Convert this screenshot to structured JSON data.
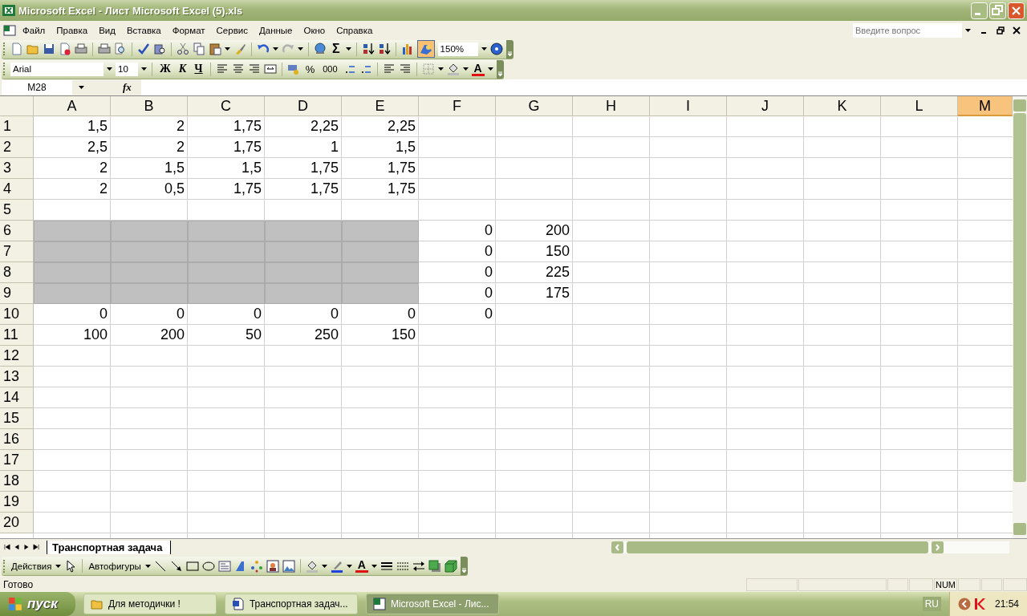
{
  "window": {
    "title": "Microsoft Excel - Лист Microsoft Excel (5).xls"
  },
  "menu": [
    "Файл",
    "Правка",
    "Вид",
    "Вставка",
    "Формат",
    "Сервис",
    "Данные",
    "Окно",
    "Справка"
  ],
  "help_box": {
    "placeholder": "Введите вопрос"
  },
  "standard_toolbar": {
    "autosum": "Σ",
    "drawing_pressed": true,
    "zoom": "150%"
  },
  "formatting_toolbar": {
    "font": "Arial",
    "size": "10",
    "bold": "Ж",
    "italic": "К",
    "underline": "Ч",
    "percent": "%",
    "thousands": "000",
    "font_color": "A"
  },
  "formula_bar": {
    "name_box": "M28",
    "fx": "fx"
  },
  "grid": {
    "columns": [
      {
        "label": "A",
        "selected": false
      },
      {
        "label": "B",
        "selected": false
      },
      {
        "label": "C",
        "selected": false
      },
      {
        "label": "D",
        "selected": false
      },
      {
        "label": "E",
        "selected": false
      },
      {
        "label": "F",
        "selected": false
      },
      {
        "label": "G",
        "selected": false
      },
      {
        "label": "H",
        "selected": false
      },
      {
        "label": "I",
        "selected": false
      },
      {
        "label": "J",
        "selected": false
      },
      {
        "label": "K",
        "selected": false
      },
      {
        "label": "L",
        "selected": false
      },
      {
        "label": "M",
        "selected": true
      }
    ],
    "rows": [
      {
        "label": "1",
        "cells": [
          {
            "value": "1,5",
            "shaded": false
          },
          {
            "value": "2",
            "shaded": false
          },
          {
            "value": "1,75",
            "shaded": false
          },
          {
            "value": "2,25",
            "shaded": false
          },
          {
            "value": "2,25",
            "shaded": false
          }
        ]
      },
      {
        "label": "2",
        "cells": [
          {
            "value": "2,5",
            "shaded": false
          },
          {
            "value": "2",
            "shaded": false
          },
          {
            "value": "1,75",
            "shaded": false
          },
          {
            "value": "1",
            "shaded": false
          },
          {
            "value": "1,5",
            "shaded": false
          }
        ]
      },
      {
        "label": "3",
        "cells": [
          {
            "value": "2",
            "shaded": false
          },
          {
            "value": "1,5",
            "shaded": false
          },
          {
            "value": "1,5",
            "shaded": false
          },
          {
            "value": "1,75",
            "shaded": false
          },
          {
            "value": "1,75",
            "shaded": false
          }
        ]
      },
      {
        "label": "4",
        "cells": [
          {
            "value": "2",
            "shaded": false
          },
          {
            "value": "0,5",
            "shaded": false
          },
          {
            "value": "1,75",
            "shaded": false
          },
          {
            "value": "1,75",
            "shaded": false
          },
          {
            "value": "1,75",
            "shaded": false
          }
        ]
      },
      {
        "label": "5"
      },
      {
        "label": "6",
        "cells": [
          {
            "shaded": true
          },
          {
            "shaded": true
          },
          {
            "shaded": true
          },
          {
            "shaded": true
          },
          {
            "shaded": true
          },
          {
            "value": "0",
            "shaded": false
          },
          {
            "value": "200",
            "shaded": false
          }
        ]
      },
      {
        "label": "7",
        "cells": [
          {
            "shaded": true
          },
          {
            "shaded": true
          },
          {
            "shaded": true
          },
          {
            "shaded": true
          },
          {
            "shaded": true
          },
          {
            "value": "0",
            "shaded": false
          },
          {
            "value": "150",
            "shaded": false
          }
        ]
      },
      {
        "label": "8",
        "cells": [
          {
            "shaded": true
          },
          {
            "shaded": true
          },
          {
            "shaded": true
          },
          {
            "shaded": true
          },
          {
            "shaded": true
          },
          {
            "value": "0",
            "shaded": false
          },
          {
            "value": "225",
            "shaded": false
          }
        ]
      },
      {
        "label": "9",
        "cells": [
          {
            "shaded": true
          },
          {
            "shaded": true
          },
          {
            "shaded": true
          },
          {
            "shaded": true
          },
          {
            "shaded": true
          },
          {
            "value": "0",
            "shaded": false
          },
          {
            "value": "175",
            "shaded": false
          }
        ]
      },
      {
        "label": "10",
        "cells": [
          {
            "value": "0",
            "shaded": false
          },
          {
            "value": "0",
            "shaded": false
          },
          {
            "value": "0",
            "shaded": false
          },
          {
            "value": "0",
            "shaded": false
          },
          {
            "value": "0",
            "shaded": false
          },
          {
            "value": "0",
            "shaded": false
          }
        ]
      },
      {
        "label": "11",
        "cells": [
          {
            "value": "100",
            "shaded": false
          },
          {
            "value": "200",
            "shaded": false
          },
          {
            "value": "50",
            "shaded": false
          },
          {
            "value": "250",
            "shaded": false
          },
          {
            "value": "150",
            "shaded": false
          }
        ]
      },
      {
        "label": "12"
      },
      {
        "label": "13"
      },
      {
        "label": "14"
      },
      {
        "label": "15"
      },
      {
        "label": "16"
      },
      {
        "label": "17"
      },
      {
        "label": "18"
      },
      {
        "label": "19"
      },
      {
        "label": "20"
      }
    ]
  },
  "sheet_tabs": [
    {
      "label": "Транспортная задача",
      "selected": true
    }
  ],
  "drawing_toolbar": {
    "actions": "Действия",
    "autoshapes": "Автофигуры",
    "font_color": "A"
  },
  "status_bar": {
    "message": "Готово",
    "indicator": "NUM"
  },
  "taskbar": {
    "start": "пуск",
    "tasks": [
      {
        "label": "Для методички !",
        "kind": "folder",
        "selected": false
      },
      {
        "label": "Транспортная задач...",
        "kind": "word",
        "selected": false
      },
      {
        "label": "Microsoft Excel - Лис...",
        "kind": "excel",
        "selected": true
      }
    ],
    "language": "RU",
    "clock": "21:54"
  }
}
